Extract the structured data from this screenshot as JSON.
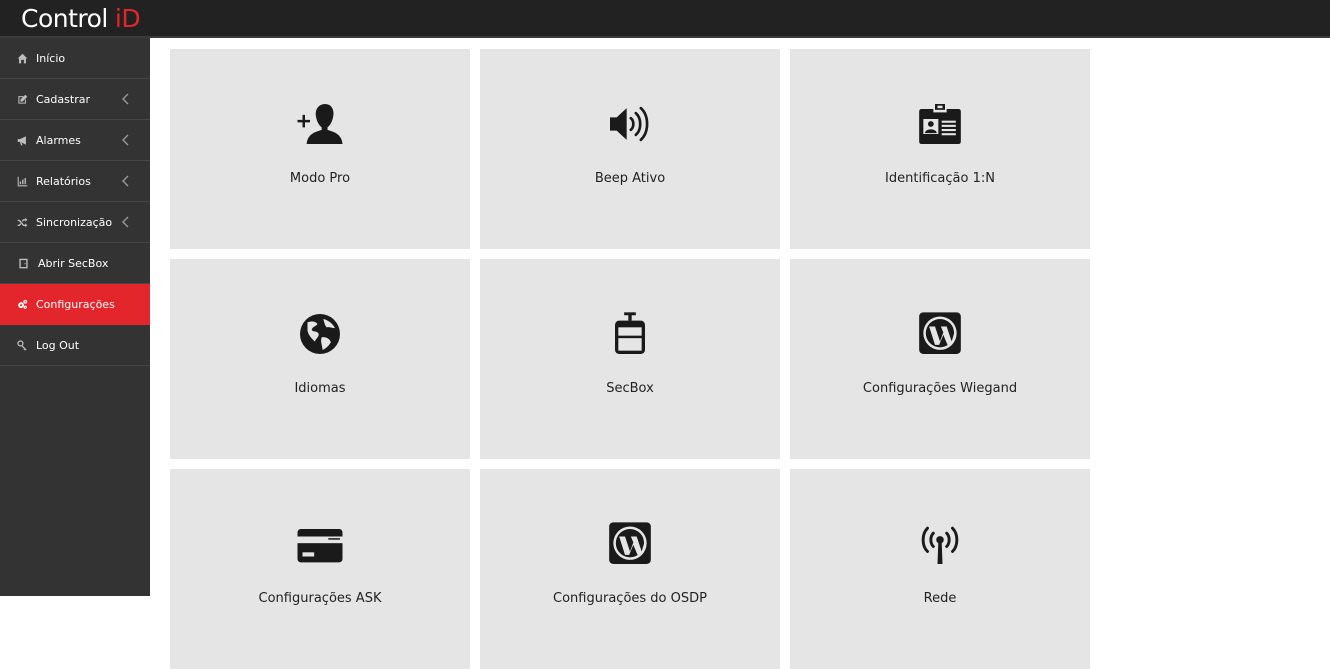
{
  "app": {
    "logo_text": "Control",
    "logo_accent": "iD",
    "accent_color": "#e3262b"
  },
  "sidebar": {
    "items": [
      {
        "label": "Início",
        "icon": "home-icon",
        "has_chevron": false,
        "active": false
      },
      {
        "label": "Cadastrar",
        "icon": "edit-icon",
        "has_chevron": true,
        "active": false
      },
      {
        "label": "Alarmes",
        "icon": "bullhorn-icon",
        "has_chevron": true,
        "active": false
      },
      {
        "label": "Relatórios",
        "icon": "bar-chart-icon",
        "has_chevron": true,
        "active": false
      },
      {
        "label": "Sincronização",
        "icon": "random-icon",
        "has_chevron": true,
        "active": false
      },
      {
        "label": "Abrir SecBox",
        "icon": "door-icon",
        "has_chevron": false,
        "active": false
      },
      {
        "label": "Configurações",
        "icon": "gears-icon",
        "has_chevron": false,
        "active": true
      },
      {
        "label": "Log Out",
        "icon": "key-icon",
        "has_chevron": false,
        "active": false
      }
    ]
  },
  "tiles": [
    {
      "label": "Modo Pro",
      "icon": "add-user-icon"
    },
    {
      "label": "Beep Ativo",
      "icon": "volume-up-icon"
    },
    {
      "label": "Identificação 1:N",
      "icon": "id-badge-icon"
    },
    {
      "label": "Idiomas",
      "icon": "globe-icon"
    },
    {
      "label": "SecBox",
      "icon": "suitcase-icon"
    },
    {
      "label": "Configurações Wiegand",
      "icon": "wordpress-icon"
    },
    {
      "label": "Configurações ASK",
      "icon": "credit-card-icon"
    },
    {
      "label": "Configurações do OSDP",
      "icon": "wordpress-icon"
    },
    {
      "label": "Rede",
      "icon": "antenna-icon"
    }
  ]
}
